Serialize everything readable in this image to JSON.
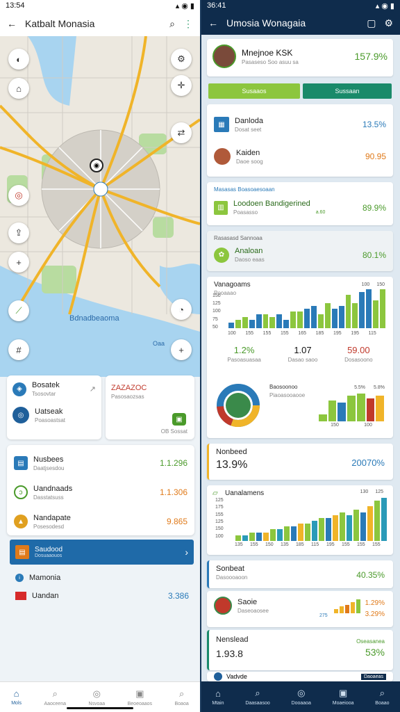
{
  "left": {
    "status": {
      "time": "13:54"
    },
    "title": "Katbalt Monasia",
    "map": {
      "label": "Bdnadbeaoma",
      "label2": "Oaa"
    },
    "quick": [
      {
        "title": "Bosatek",
        "sub": "Tsosovtar"
      },
      {
        "title": "Uatseak",
        "sub": "Poasoastsat"
      },
      {
        "title": "ZAZAZOC",
        "sub": "Pasosaozsas"
      },
      {
        "badge": "OB Sossat"
      }
    ],
    "items": [
      {
        "title": "Nusbees",
        "sub": "Daatjsesdou",
        "value": "1.1.296",
        "color": "#4a9a2a",
        "icon": "store-icon",
        "ic": "#2a7ab8"
      },
      {
        "title": "Uandnaads",
        "sub": "Dasstatsuss",
        "value": "1.1.306",
        "color": "#e07a1a",
        "icon": "leaf-icon",
        "ic": "#4a9a2a"
      },
      {
        "title": "Nandapate",
        "sub": "Posesodesd",
        "value": "9.865",
        "color": "#e07a1a",
        "icon": "tag-icon",
        "ic": "#e0a020"
      }
    ],
    "highlight": {
      "title": "Saudood",
      "sub": "Dosuaaouos"
    },
    "extra": [
      {
        "title": "Mamonia",
        "value": ""
      },
      {
        "title": "Uandan",
        "value": "3.386"
      }
    ],
    "nav": [
      "Mols",
      "Aaoceena",
      "Nsvoaa",
      "Beoeoaaos",
      "Boaoa"
    ]
  },
  "right": {
    "status": {
      "time": "36:41"
    },
    "title": "Umosia Wonagaia",
    "profile": {
      "name": "Mnejnoe KSK",
      "sub": "Pasaseso Soo asuu sa",
      "value": "157.9%"
    },
    "buttons": {
      "left": "Susaaos",
      "right": "Sussaan"
    },
    "entries": [
      {
        "title": "Danloda",
        "sub": "Dosat seet",
        "value": "13.5%",
        "color": "#2a7ab8"
      },
      {
        "title": "Kaiden",
        "sub": "Daoe soog",
        "value": "90.95",
        "color": "#e07a1a"
      }
    ],
    "section1": {
      "header": "Masasas Boasoaesoaan",
      "title": "Loodoen Bandigerined",
      "sub": "Poasasso",
      "tag": "a.60",
      "value": "89.9%"
    },
    "section2": {
      "header": "Rasasasd Sannoaa",
      "title": "Analoan",
      "sub": "Daoso eaas",
      "value": "80.1%"
    },
    "chart1": {
      "title": "Vanagoams",
      "sub": "Pooaaao",
      "ytick": [
        "150",
        "125",
        "100",
        "75",
        "50"
      ],
      "xtick": [
        "100",
        "155",
        "155",
        "155",
        "165",
        "185",
        "195",
        "195",
        "115"
      ],
      "top_right": [
        "100",
        "150"
      ]
    },
    "stats": [
      {
        "value": "1.2%",
        "label": "Pasoasuasaa",
        "color": "#4a9a2a"
      },
      {
        "value": "1.07",
        "label": "Dasao saoo",
        "color": "#111"
      },
      {
        "value": "59.00",
        "label": "Dosasoono",
        "color": "#c0392b"
      }
    ],
    "donut": {
      "title": "Baosoonoo",
      "sub": "Piaoasooaooe",
      "bar_labels": [
        "5.5%",
        "5.8%"
      ],
      "x": [
        "150",
        "100"
      ]
    },
    "metric1": {
      "title": "Nonbeed",
      "value": "13.9%",
      "right": "20070%"
    },
    "chart2": {
      "title": "Uanalamens",
      "ytick": [
        "125",
        "175",
        "155",
        "125",
        "150",
        "100"
      ],
      "xtick": [
        "135",
        "155",
        "150",
        "135",
        "185",
        "115",
        "195",
        "155",
        "155",
        "155"
      ],
      "top": [
        "130",
        "125"
      ]
    },
    "metric2": {
      "title": "Sonbeat",
      "sub": "Dasoooaoon",
      "value": "40.35%"
    },
    "metric3": {
      "title": "Saoie",
      "sub": "Daseoaosee",
      "tag": "275",
      "v1": "1.29%",
      "v2": "3.29%"
    },
    "metric4": {
      "title": "Nenslead",
      "value": "1.93.8",
      "badge": "Oseasanea",
      "right": "53%"
    },
    "footer": {
      "title": "Vadvde",
      "badge": "Daoaeas"
    },
    "nav": [
      "Mtain",
      "Daasaasoo",
      "Dooaaoa",
      "Moaeiooa",
      "Boaao"
    ]
  },
  "chart_data": [
    {
      "type": "bar",
      "title": "Vanagoams",
      "series": [
        {
          "values": [
            2,
            3,
            4,
            3,
            5,
            5,
            4,
            5,
            3,
            6,
            6,
            7,
            8,
            5,
            9,
            7,
            8,
            12,
            9,
            13,
            14,
            10,
            14
          ]
        }
      ]
    },
    {
      "type": "pie",
      "title": "Baosoonoo",
      "values": [
        30,
        25,
        25,
        20
      ]
    },
    {
      "type": "bar",
      "title": "Uanalamens",
      "series": [
        {
          "values": [
            2,
            2,
            3,
            3,
            3,
            4,
            4,
            5,
            5,
            6,
            6,
            7,
            8,
            8,
            9,
            10,
            9,
            11,
            10,
            12,
            14,
            15
          ]
        }
      ]
    }
  ]
}
